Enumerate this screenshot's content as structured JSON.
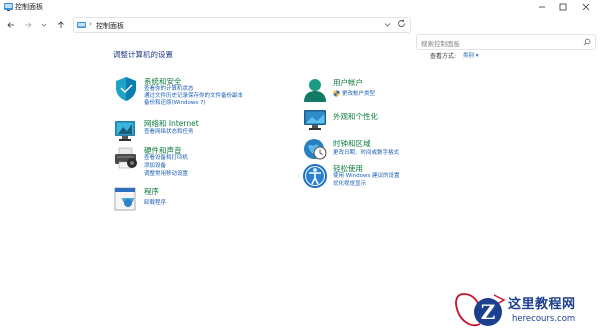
{
  "window": {
    "title": "控制面板"
  },
  "nav": {
    "address_path": "控制面板",
    "search_placeholder": "搜索控制面板"
  },
  "content": {
    "heading": "调整计算机的设置",
    "view_by_label": "查看方式:",
    "view_by_value": "类别 ▾"
  },
  "categories_left": [
    {
      "title": "系统和安全",
      "links": [
        "查看你的计算机状态",
        "通过文件历史记录保存你的文件备份副本",
        "备份和还原(Windows 7)"
      ]
    },
    {
      "title": "网络和 Internet",
      "links": [
        "查看网络状态和任务"
      ]
    },
    {
      "title": "硬件和声音",
      "links": [
        "查看设备和打印机",
        "添加设备",
        "调整常用移动设置"
      ]
    },
    {
      "title": "程序",
      "links": [
        "卸载程序"
      ]
    }
  ],
  "categories_right": [
    {
      "title": "用户帐户",
      "links": [
        "更改帐户类型"
      ]
    },
    {
      "title": "外观和个性化",
      "links": []
    },
    {
      "title": "时钟和区域",
      "links": [
        "更改日期、时间或数字格式"
      ]
    },
    {
      "title": "轻松使用",
      "links": [
        "使用 Windows 建议的设置",
        "优化视觉显示"
      ]
    }
  ],
  "watermark": {
    "logo_letter": "Z",
    "name": "这里教程网",
    "url": "herecours.com"
  },
  "colors": {
    "title_link": "#0b7a3b",
    "link": "#1a5fb4",
    "heading": "#1f3b8c"
  }
}
